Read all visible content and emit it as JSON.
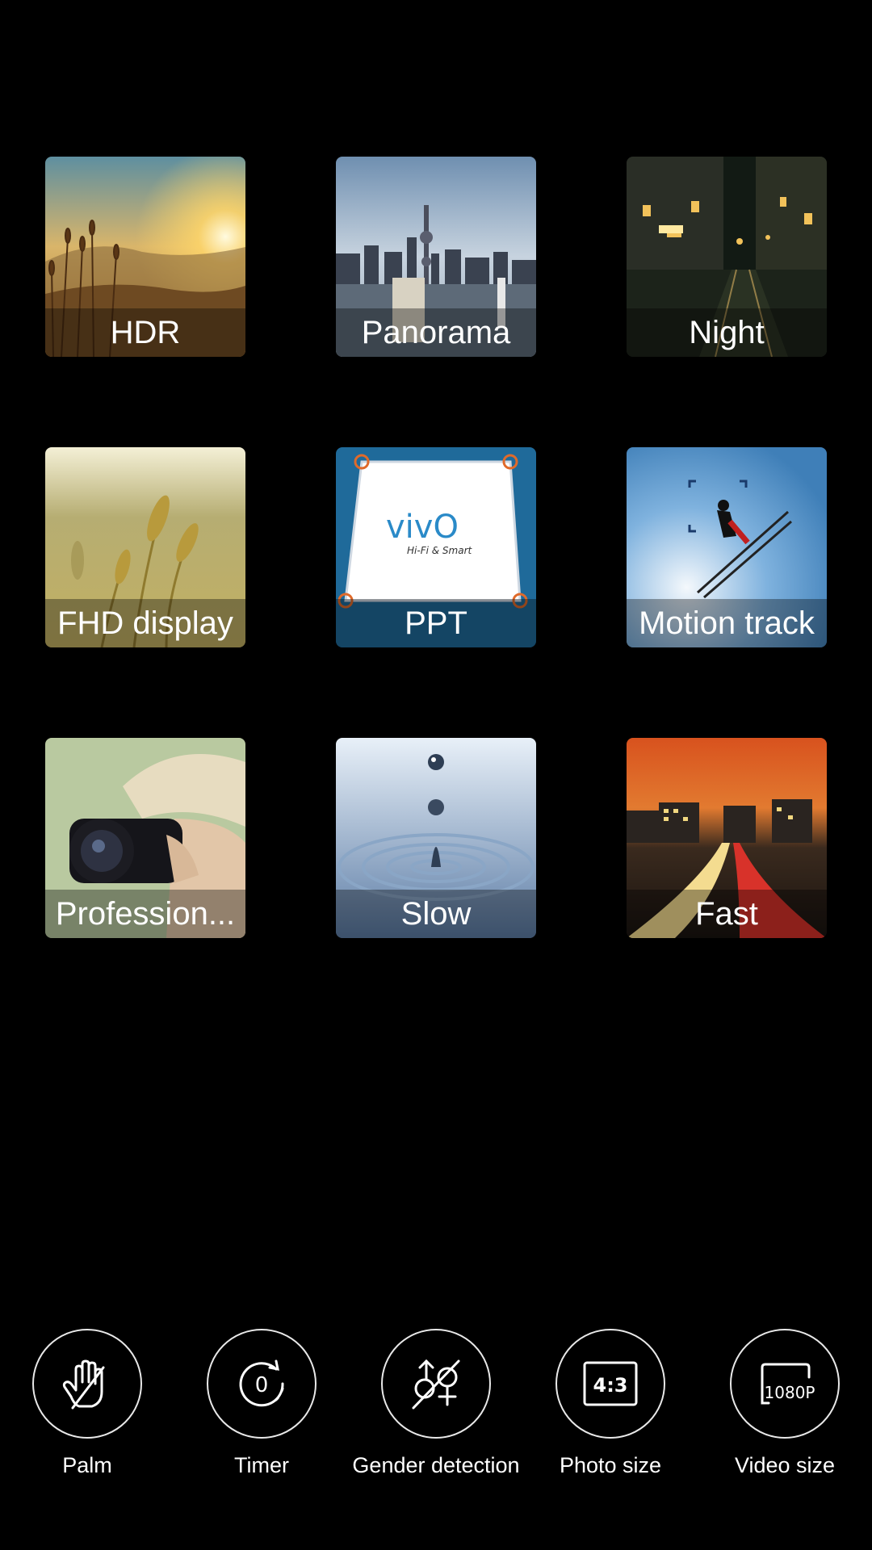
{
  "modes": [
    {
      "id": "hdr",
      "label": "HDR"
    },
    {
      "id": "panorama",
      "label": "Panorama"
    },
    {
      "id": "night",
      "label": "Night"
    },
    {
      "id": "fhd",
      "label": "FHD display"
    },
    {
      "id": "ppt",
      "label": "PPT",
      "logo_text": "vivO",
      "logo_tagline": "Hi-Fi & Smart"
    },
    {
      "id": "motion",
      "label": "Motion track"
    },
    {
      "id": "pro",
      "label": "Profession..."
    },
    {
      "id": "slow",
      "label": "Slow"
    },
    {
      "id": "fast",
      "label": "Fast"
    }
  ],
  "settings": [
    {
      "id": "palm",
      "label": "Palm",
      "icon": "palm-icon"
    },
    {
      "id": "timer",
      "label": "Timer",
      "icon": "timer-icon",
      "value": "0"
    },
    {
      "id": "gender",
      "label": "Gender detection",
      "icon": "gender-detection-icon"
    },
    {
      "id": "photo-size",
      "label": "Photo size",
      "icon": "photo-size-icon",
      "value": "4:3"
    },
    {
      "id": "video-size",
      "label": "Video size",
      "icon": "video-size-icon",
      "value": "1080P"
    }
  ]
}
